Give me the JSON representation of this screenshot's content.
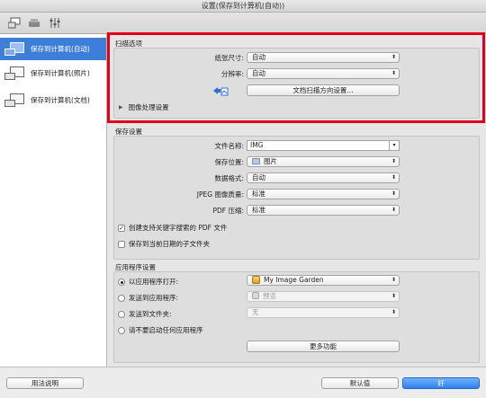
{
  "window": {
    "title": "设置(保存到计算机(自动))"
  },
  "sidebar": {
    "items": [
      {
        "label": "保存到计算机(自动)",
        "selected": true
      },
      {
        "label": "保存到计算机(照片)",
        "selected": false
      },
      {
        "label": "保存到计算机(文档)",
        "selected": false
      }
    ]
  },
  "scan_options": {
    "title": "扫描选项",
    "paper_size": {
      "label": "纸张尺寸:",
      "value": "自动"
    },
    "resolution": {
      "label": "分辨率:",
      "value": "自动"
    },
    "orientation_button": "文档扫描方向设置...",
    "image_processing": "图像处理设置"
  },
  "save_settings": {
    "title": "保存设置",
    "file_name": {
      "label": "文件名称:",
      "value": "IMG"
    },
    "save_in": {
      "label": "保存位置:",
      "value": "图片"
    },
    "data_format": {
      "label": "数据格式:",
      "value": "自动"
    },
    "jpeg_quality": {
      "label": "JPEG 图像质量:",
      "value": "标准"
    },
    "pdf_compression": {
      "label": "PDF 压缩:",
      "value": "标准"
    },
    "create_searchable_pdf": {
      "label": "创建支持关键字搜索的 PDF 文件",
      "checked": true
    },
    "save_subfolder": {
      "label": "保存到当前日期的子文件夹",
      "checked": false
    }
  },
  "app_settings": {
    "title": "应用程序设置",
    "open_with": {
      "label": "以应用程序打开:",
      "value": "My Image Garden",
      "selected": true
    },
    "send_to_app": {
      "label": "发送到应用程序:",
      "value": "预览",
      "selected": false
    },
    "send_to_folder": {
      "label": "发送到文件夹:",
      "value": "无",
      "selected": false
    },
    "do_not_start": {
      "label": "请不要启动任何应用程序",
      "selected": false
    },
    "more_functions": "更多功能"
  },
  "footer": {
    "help": "用法说明",
    "defaults": "默认值",
    "ok": "好"
  },
  "accent_color": "#3d7fd8",
  "highlight_color": "#e0001b"
}
